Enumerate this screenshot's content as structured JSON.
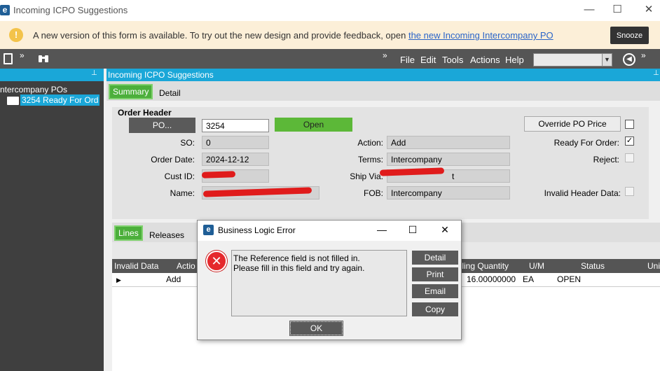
{
  "window": {
    "title": "Incoming ICPO Suggestions",
    "logo": "e",
    "minimize": "—",
    "maximize": "☐",
    "close": "✕"
  },
  "banner": {
    "icon": "!",
    "text": "A new version of this form is available. To try out the new design and provide feedback, open ",
    "link": "the new Incoming Intercompany PO",
    "snooze": "Snooze"
  },
  "toolbar": {
    "menus": [
      "File",
      "Edit",
      "Tools",
      "Actions",
      "Help"
    ],
    "back_icon": "◀"
  },
  "left_panel": {
    "pin": "⊥",
    "root": "ntercompany POs",
    "item": "3254 Ready For Ord"
  },
  "main": {
    "title": "Incoming ICPO Suggestions",
    "pin": "⊥",
    "tabs": [
      "Summary",
      "Detail"
    ]
  },
  "order_header": {
    "title": "Order Header",
    "po_button": "PO...",
    "po_value": "3254",
    "status": "Open",
    "so_label": "SO:",
    "so_value": "0",
    "order_date_label": "Order Date:",
    "order_date_value": "2024-12-12",
    "cust_id_label": "Cust ID:",
    "name_label": "Name:",
    "action_label": "Action:",
    "action_value": "Add",
    "terms_label": "Terms:",
    "terms_value": "Intercompany",
    "ship_via_label": "Ship Via:",
    "ship_via_value_partial": "t",
    "fob_label": "FOB:",
    "fob_value": "Intercompany",
    "override_button": "Override PO Price",
    "ready_label": "Ready For Order:",
    "ready_checked": "✓",
    "reject_label": "Reject:",
    "invalid_label": "Invalid Header Data:"
  },
  "lines": {
    "tabs": [
      "Lines",
      "Releases"
    ],
    "columns": [
      "Invalid Data",
      "Actio",
      "elling Quantity",
      "U/M",
      "Status",
      "Uni"
    ],
    "row": {
      "marker": "▶",
      "action": "Add",
      "qty": "16.00000000",
      "um": "EA",
      "status": "OPEN"
    }
  },
  "dialog": {
    "title": "Business Logic Error",
    "logo": "e",
    "minimize": "—",
    "maximize": "☐",
    "close": "✕",
    "error_icon": "✕",
    "message_line1": "The Reference field is not filled in.",
    "message_line2": "Please fill in this field and try again.",
    "buttons": [
      "Detail",
      "Print",
      "Email",
      "Copy"
    ],
    "ok": "OK"
  }
}
